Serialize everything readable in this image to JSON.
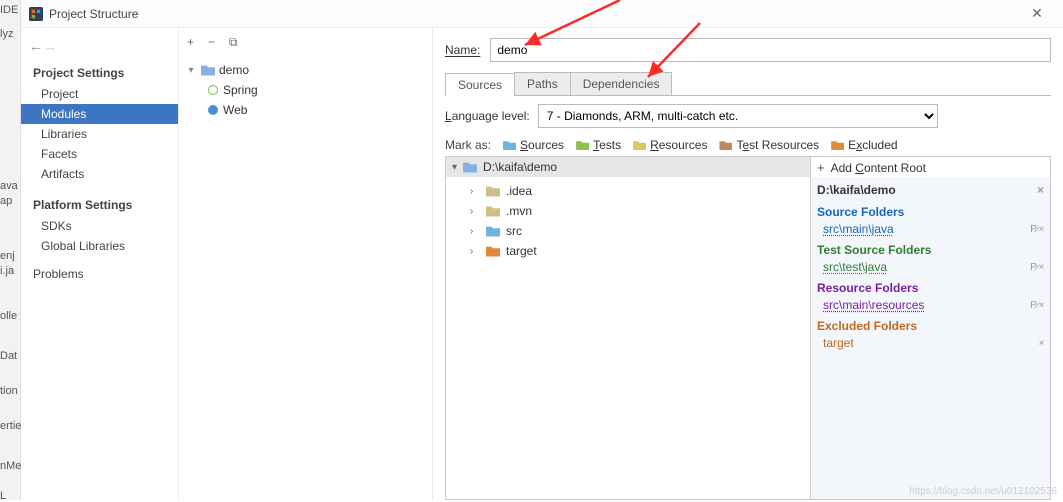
{
  "bg_labels": [
    "IDE",
    "lyz",
    "ava",
    "ap",
    "enj",
    "i.ja",
    "olle",
    "Dat",
    "tion",
    "ertie",
    "nMe",
    "L"
  ],
  "window": {
    "title": "Project Structure"
  },
  "nav": {
    "project_settings_header": "Project Settings",
    "project_settings": [
      "Project",
      "Modules",
      "Libraries",
      "Facets",
      "Artifacts"
    ],
    "selected": "Modules",
    "platform_settings_header": "Platform Settings",
    "platform_settings": [
      "SDKs",
      "Global Libraries"
    ],
    "problems": "Problems"
  },
  "module_tree": {
    "root": "demo",
    "children": [
      {
        "icon": "spring",
        "label": "Spring"
      },
      {
        "icon": "web",
        "label": "Web"
      }
    ]
  },
  "name_label": "Name:",
  "name_value": "demo",
  "tabs": {
    "items": [
      "Sources",
      "Paths",
      "Dependencies"
    ],
    "active": "Sources"
  },
  "language_level": {
    "label": "Language level:",
    "value": "7 - Diamonds, ARM, multi-catch etc."
  },
  "mark_as": {
    "label": "Mark as:",
    "sources": "Sources",
    "tests": "Tests",
    "resources": "Resources",
    "test_resources": "Test Resources",
    "excluded": "Excluded"
  },
  "dir_tree": {
    "root": "D:\\kaifa\\demo",
    "rows": [
      {
        "kind": "grey",
        "label": ".idea"
      },
      {
        "kind": "grey",
        "label": ".mvn"
      },
      {
        "kind": "blue",
        "label": "src"
      },
      {
        "kind": "orange",
        "label": "target"
      }
    ]
  },
  "roots": {
    "add_label": "Add Content Root",
    "root_path": "D:\\kaifa\\demo",
    "sections": [
      {
        "header": "Source Folders",
        "cls": "c-src",
        "entries": [
          {
            "path": "src\\main\\java",
            "tag": "P̷ ×"
          }
        ]
      },
      {
        "header": "Test Source Folders",
        "cls": "c-tst",
        "entries": [
          {
            "path": "src\\test\\java",
            "tag": "P̷ ×"
          }
        ]
      },
      {
        "header": "Resource Folders",
        "cls": "c-res",
        "entries": [
          {
            "path": "src\\main\\resources",
            "tag": "P̷ ×"
          }
        ]
      },
      {
        "header": "Excluded Folders",
        "cls": "c-exc",
        "entries": [
          {
            "path": "target",
            "tag": "×"
          }
        ]
      }
    ]
  },
  "watermark": "https://blog.csdn.net/u012102536"
}
